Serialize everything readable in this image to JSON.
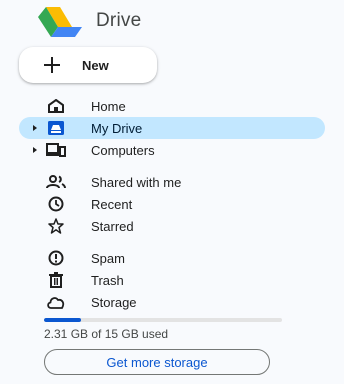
{
  "app": {
    "title": "Drive"
  },
  "new_button": {
    "label": "New"
  },
  "nav": {
    "items": [
      {
        "label": "Home"
      },
      {
        "label": "My Drive"
      },
      {
        "label": "Computers"
      },
      {
        "label": "Shared with me"
      },
      {
        "label": "Recent"
      },
      {
        "label": "Starred"
      },
      {
        "label": "Spam"
      },
      {
        "label": "Trash"
      },
      {
        "label": "Storage"
      }
    ]
  },
  "storage": {
    "used_text": "2.31 GB of 15 GB used",
    "used_fraction": 0.154,
    "cta_label": "Get more storage"
  },
  "colors": {
    "accent": "#0b57d0",
    "active_bg": "#c2e7ff",
    "page_bg": "#f8fafd"
  },
  "icons": {
    "logo": "google-drive-logo",
    "new": "plus-icon",
    "home": "home-icon",
    "my_drive": "my-drive-icon",
    "computers": "computers-icon",
    "shared": "people-icon",
    "recent": "clock-icon",
    "starred": "star-icon",
    "spam": "spam-icon",
    "trash": "trash-icon",
    "storage": "cloud-icon"
  }
}
